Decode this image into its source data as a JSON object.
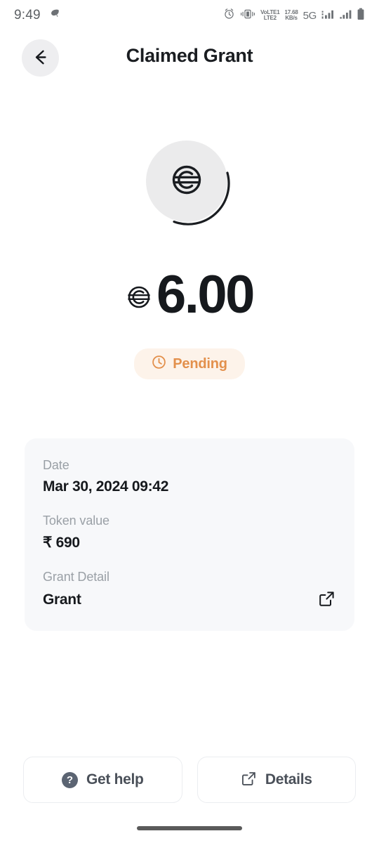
{
  "status_bar": {
    "time": "9:49",
    "leaf_icon": "leaf-icon",
    "alarm_icon": "alarm-icon",
    "vibrate_icon": "vibrate-icon",
    "volte_line1": "VoLTE1",
    "volte_line2": "LTE2",
    "data_rate_value": "17.68",
    "data_rate_unit": "KB/s",
    "network": "5G",
    "signal_icon_1": "signal-bars-icon",
    "signal_icon_2": "signal-bars-icon",
    "battery_icon": "battery-icon"
  },
  "header": {
    "back_icon": "back-arrow-icon",
    "title": "Claimed Grant"
  },
  "token": {
    "logo_icon": "token-logo-icon",
    "circle_color": "#EBEBEC",
    "arc_color": "#1A1D21"
  },
  "amount": {
    "symbol_icon": "token-symbol-icon",
    "value": "6.00"
  },
  "status_pill": {
    "icon": "clock-icon",
    "label": "Pending",
    "text_color": "#E3904C",
    "background_color": "#FDF3EA"
  },
  "detail_card": {
    "background_color": "#F7F8FA",
    "fields": [
      {
        "label": "Date",
        "value": "Mar 30, 2024 09:42"
      },
      {
        "label": "Token value",
        "value": "₹ 690"
      },
      {
        "label": "Grant Detail",
        "value": "Grant",
        "action_icon": "external-link-icon"
      }
    ]
  },
  "actions": {
    "get_help": {
      "icon": "help-circle-icon",
      "icon_glyph": "?",
      "label": "Get help"
    },
    "details": {
      "icon": "external-link-icon",
      "label": "Details"
    }
  },
  "gesture_bar": {
    "name": "home-indicator"
  }
}
